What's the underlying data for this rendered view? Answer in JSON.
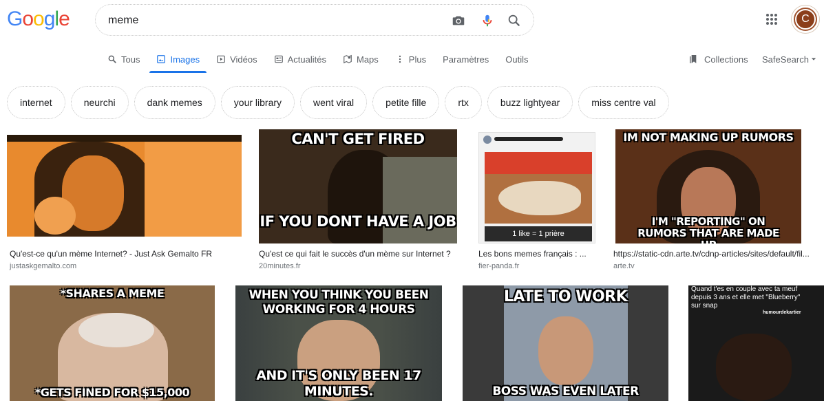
{
  "logo": {
    "text": "Google",
    "letters": [
      "G",
      "o",
      "o",
      "g",
      "l",
      "e"
    ],
    "colors": [
      "#4285f4",
      "#ea4335",
      "#fbbc05",
      "#4285f4",
      "#34a853",
      "#ea4335"
    ]
  },
  "search": {
    "value": "meme",
    "placeholder": ""
  },
  "header": {
    "avatar_letter": "C",
    "camera_icon": "camera-icon",
    "mic_icon": "mic-icon",
    "search_icon": "search-icon",
    "apps_icon": "apps-grid-icon"
  },
  "tabs": [
    {
      "label": "Tous",
      "icon": "search-icon",
      "active": false
    },
    {
      "label": "Images",
      "icon": "image-icon",
      "active": true
    },
    {
      "label": "Vidéos",
      "icon": "video-icon",
      "active": false
    },
    {
      "label": "Actualités",
      "icon": "news-icon",
      "active": false
    },
    {
      "label": "Maps",
      "icon": "map-icon",
      "active": false
    },
    {
      "label": "Plus",
      "icon": "more-vert-icon",
      "active": false
    },
    {
      "label": "Paramètres",
      "icon": "",
      "active": false
    },
    {
      "label": "Outils",
      "icon": "",
      "active": false
    }
  ],
  "right_tools": {
    "collections": "Collections",
    "safesearch": "SafeSearch"
  },
  "chips": [
    "internet",
    "neurchi",
    "dank memes",
    "your library",
    "went viral",
    "petite fille",
    "rtx",
    "buzz lightyear",
    "miss centre val"
  ],
  "results_row1": [
    {
      "title": "Qu'est-ce qu'un mème Internet? - Just Ask Gemalto FR",
      "source": "justaskgemalto.com",
      "meme_top": "",
      "meme_bottom": ""
    },
    {
      "title": "Qu'est ce qui fait le succès d'un mème sur Internet ?",
      "source": "20minutes.fr",
      "meme_top": "CAN'T GET FIRED",
      "meme_bottom": "IF YOU DONT HAVE A JOB"
    },
    {
      "title": "Les bons memes français : ...",
      "source": "fier-panda.fr",
      "meme_top": "",
      "meme_bottom": "1 like = 1 prière"
    },
    {
      "title": "https://static-cdn.arte.tv/cdnp-articles/sites/default/fil...",
      "source": "arte.tv",
      "meme_top": "IM NOT MAKING UP RUMORS",
      "meme_bottom": "I'M \"REPORTING\" ON RUMORS THAT ARE MADE UP"
    }
  ],
  "results_row2": [
    {
      "meme_top": "*SHARES A MEME",
      "meme_bottom": "*GETS FINED FOR $15,000"
    },
    {
      "meme_top": "WHEN YOU THINK YOU BEEN WORKING FOR 4 HOURS",
      "meme_bottom": "AND IT'S ONLY BEEN 17 MINUTES."
    },
    {
      "meme_top": "LATE TO WORK",
      "meme_bottom": "BOSS WAS EVEN LATER"
    },
    {
      "meme_top": "Quand t'es en couple avec ta meuf depuis 3 ans et elle met \"Blueberry\" sur snap",
      "meme_bottom": "humourdekartier"
    }
  ]
}
